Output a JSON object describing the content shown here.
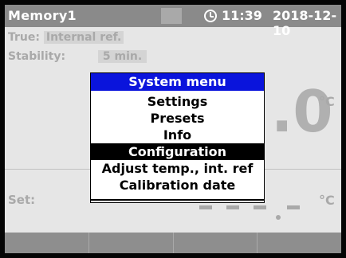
{
  "status_bar": {
    "title": "Memory1",
    "time": "11:39",
    "date": "2018-12-10",
    "icons": [
      "battery-icon",
      "clock-icon"
    ]
  },
  "info": {
    "true_label": "True:",
    "true_value": "Internal ref.",
    "stability_label": "Stability:",
    "stability_value": "5 min."
  },
  "reading": {
    "digit": ".0",
    "unit": "°C"
  },
  "set": {
    "label": "Set:",
    "unit": "°C"
  },
  "menu": {
    "title": "System menu",
    "items": [
      {
        "label": "Settings",
        "selected": false
      },
      {
        "label": "Presets",
        "selected": false
      },
      {
        "label": "Info",
        "selected": false
      },
      {
        "label": "Configuration",
        "selected": true
      },
      {
        "label": "Adjust temp., int. ref",
        "selected": false
      },
      {
        "label": "Calibration date",
        "selected": false
      }
    ]
  },
  "softkeys": [
    "",
    "",
    "",
    ""
  ],
  "colors": {
    "status_bar": "#8a8a8a",
    "menu_header": "#0a14dc",
    "selected_bg": "#000000",
    "background": "#e6e6e6"
  }
}
